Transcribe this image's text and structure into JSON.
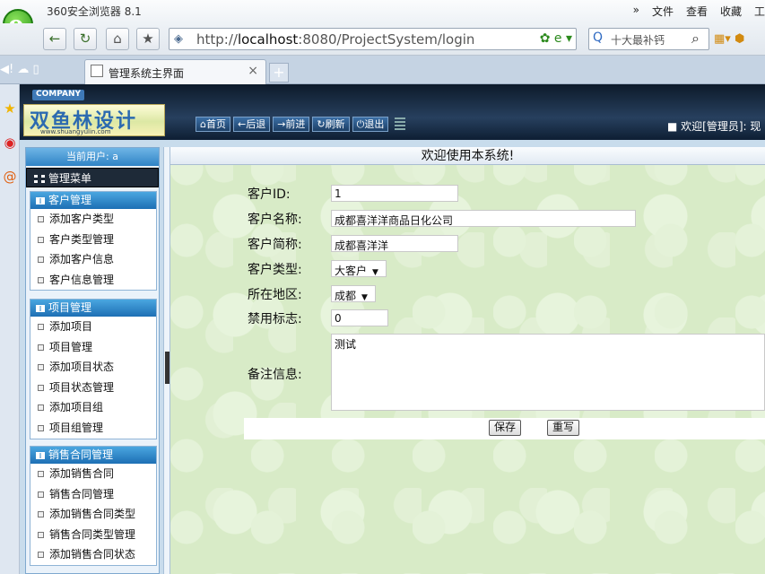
{
  "browser": {
    "app_title": "360安全浏览器 8.1",
    "menu": [
      "»",
      "文件",
      "查看",
      "收藏",
      "工"
    ],
    "url_prefix": "http://",
    "url_host": "localhost",
    "url_rest": ":8080/ProjectSystem/login",
    "search_text": "十大最补钙",
    "tab_title": "管理系统主界面",
    "tab_close": "×",
    "new_tab": "+"
  },
  "header": {
    "company_tag": "COMPANY",
    "logo_text": "双鱼林设计",
    "logo_url": "www.shuangyulin.com",
    "toolbar": [
      "首页",
      "后退",
      "前进",
      "刷新",
      "退出"
    ],
    "welcome": "■ 欢迎[管理员]: 现"
  },
  "sidebar": {
    "current_user": "当前用户: a",
    "menu_title": "管理菜单",
    "groups": [
      {
        "title": "客户管理",
        "items": [
          "添加客户类型",
          "客户类型管理",
          "添加客户信息",
          "客户信息管理"
        ]
      },
      {
        "title": "项目管理",
        "items": [
          "添加项目",
          "项目管理",
          "添加项目状态",
          "项目状态管理",
          "添加项目组",
          "项目组管理"
        ]
      },
      {
        "title": "销售合同管理",
        "items": [
          "添加销售合同",
          "销售合同管理",
          "添加销售合同类型",
          "销售合同类型管理",
          "添加销售合同状态"
        ]
      }
    ]
  },
  "content": {
    "title": "欢迎使用本系统!",
    "form": {
      "customer_id_label": "客户ID:",
      "customer_id": "1",
      "customer_name_label": "客户名称:",
      "customer_name": "成都喜洋洋商品日化公司",
      "short_name_label": "客户简称:",
      "short_name": "成都喜洋洋",
      "type_label": "客户类型:",
      "type": "大客户",
      "region_label": "所在地区:",
      "region": "成都",
      "disabled_label": "禁用标志:",
      "disabled": "0",
      "remark_label": "备注信息:",
      "remark": "测试"
    },
    "save_button": "保存",
    "reset_button": "重写"
  }
}
